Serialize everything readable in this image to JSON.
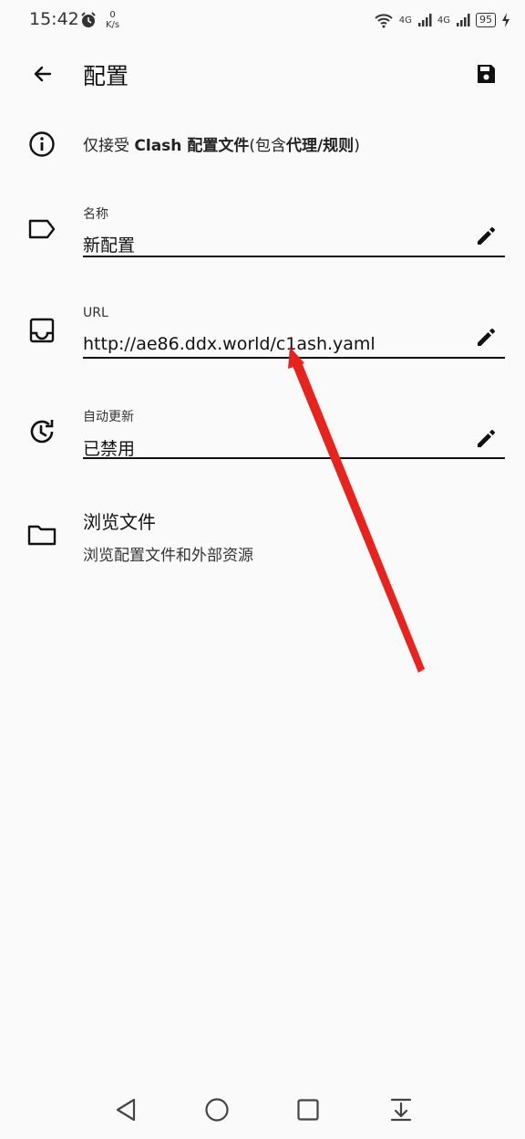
{
  "status_bar": {
    "time": "15:42",
    "speed_value": "0",
    "speed_unit": "K/s",
    "net1": "4G",
    "net2": "4G",
    "battery": "95"
  },
  "app_bar": {
    "title": "配置",
    "back_icon": "arrow-left-icon",
    "save_icon": "save-icon"
  },
  "info": {
    "prefix": "仅接受 ",
    "bold1": "Clash 配置文件",
    "mid": "(包含",
    "bold2": "代理/规则",
    "suffix": ")"
  },
  "fields": {
    "name": {
      "label": "名称",
      "value": "新配置"
    },
    "url": {
      "label": "URL",
      "value": "http://ae86.ddx.world/c1ash.yaml"
    },
    "auto_update": {
      "label": "自动更新",
      "value": "已禁用"
    }
  },
  "browse": {
    "title": "浏览文件",
    "subtitle": "浏览配置文件和外部资源"
  },
  "annotation": {
    "color": "#e8231e"
  }
}
